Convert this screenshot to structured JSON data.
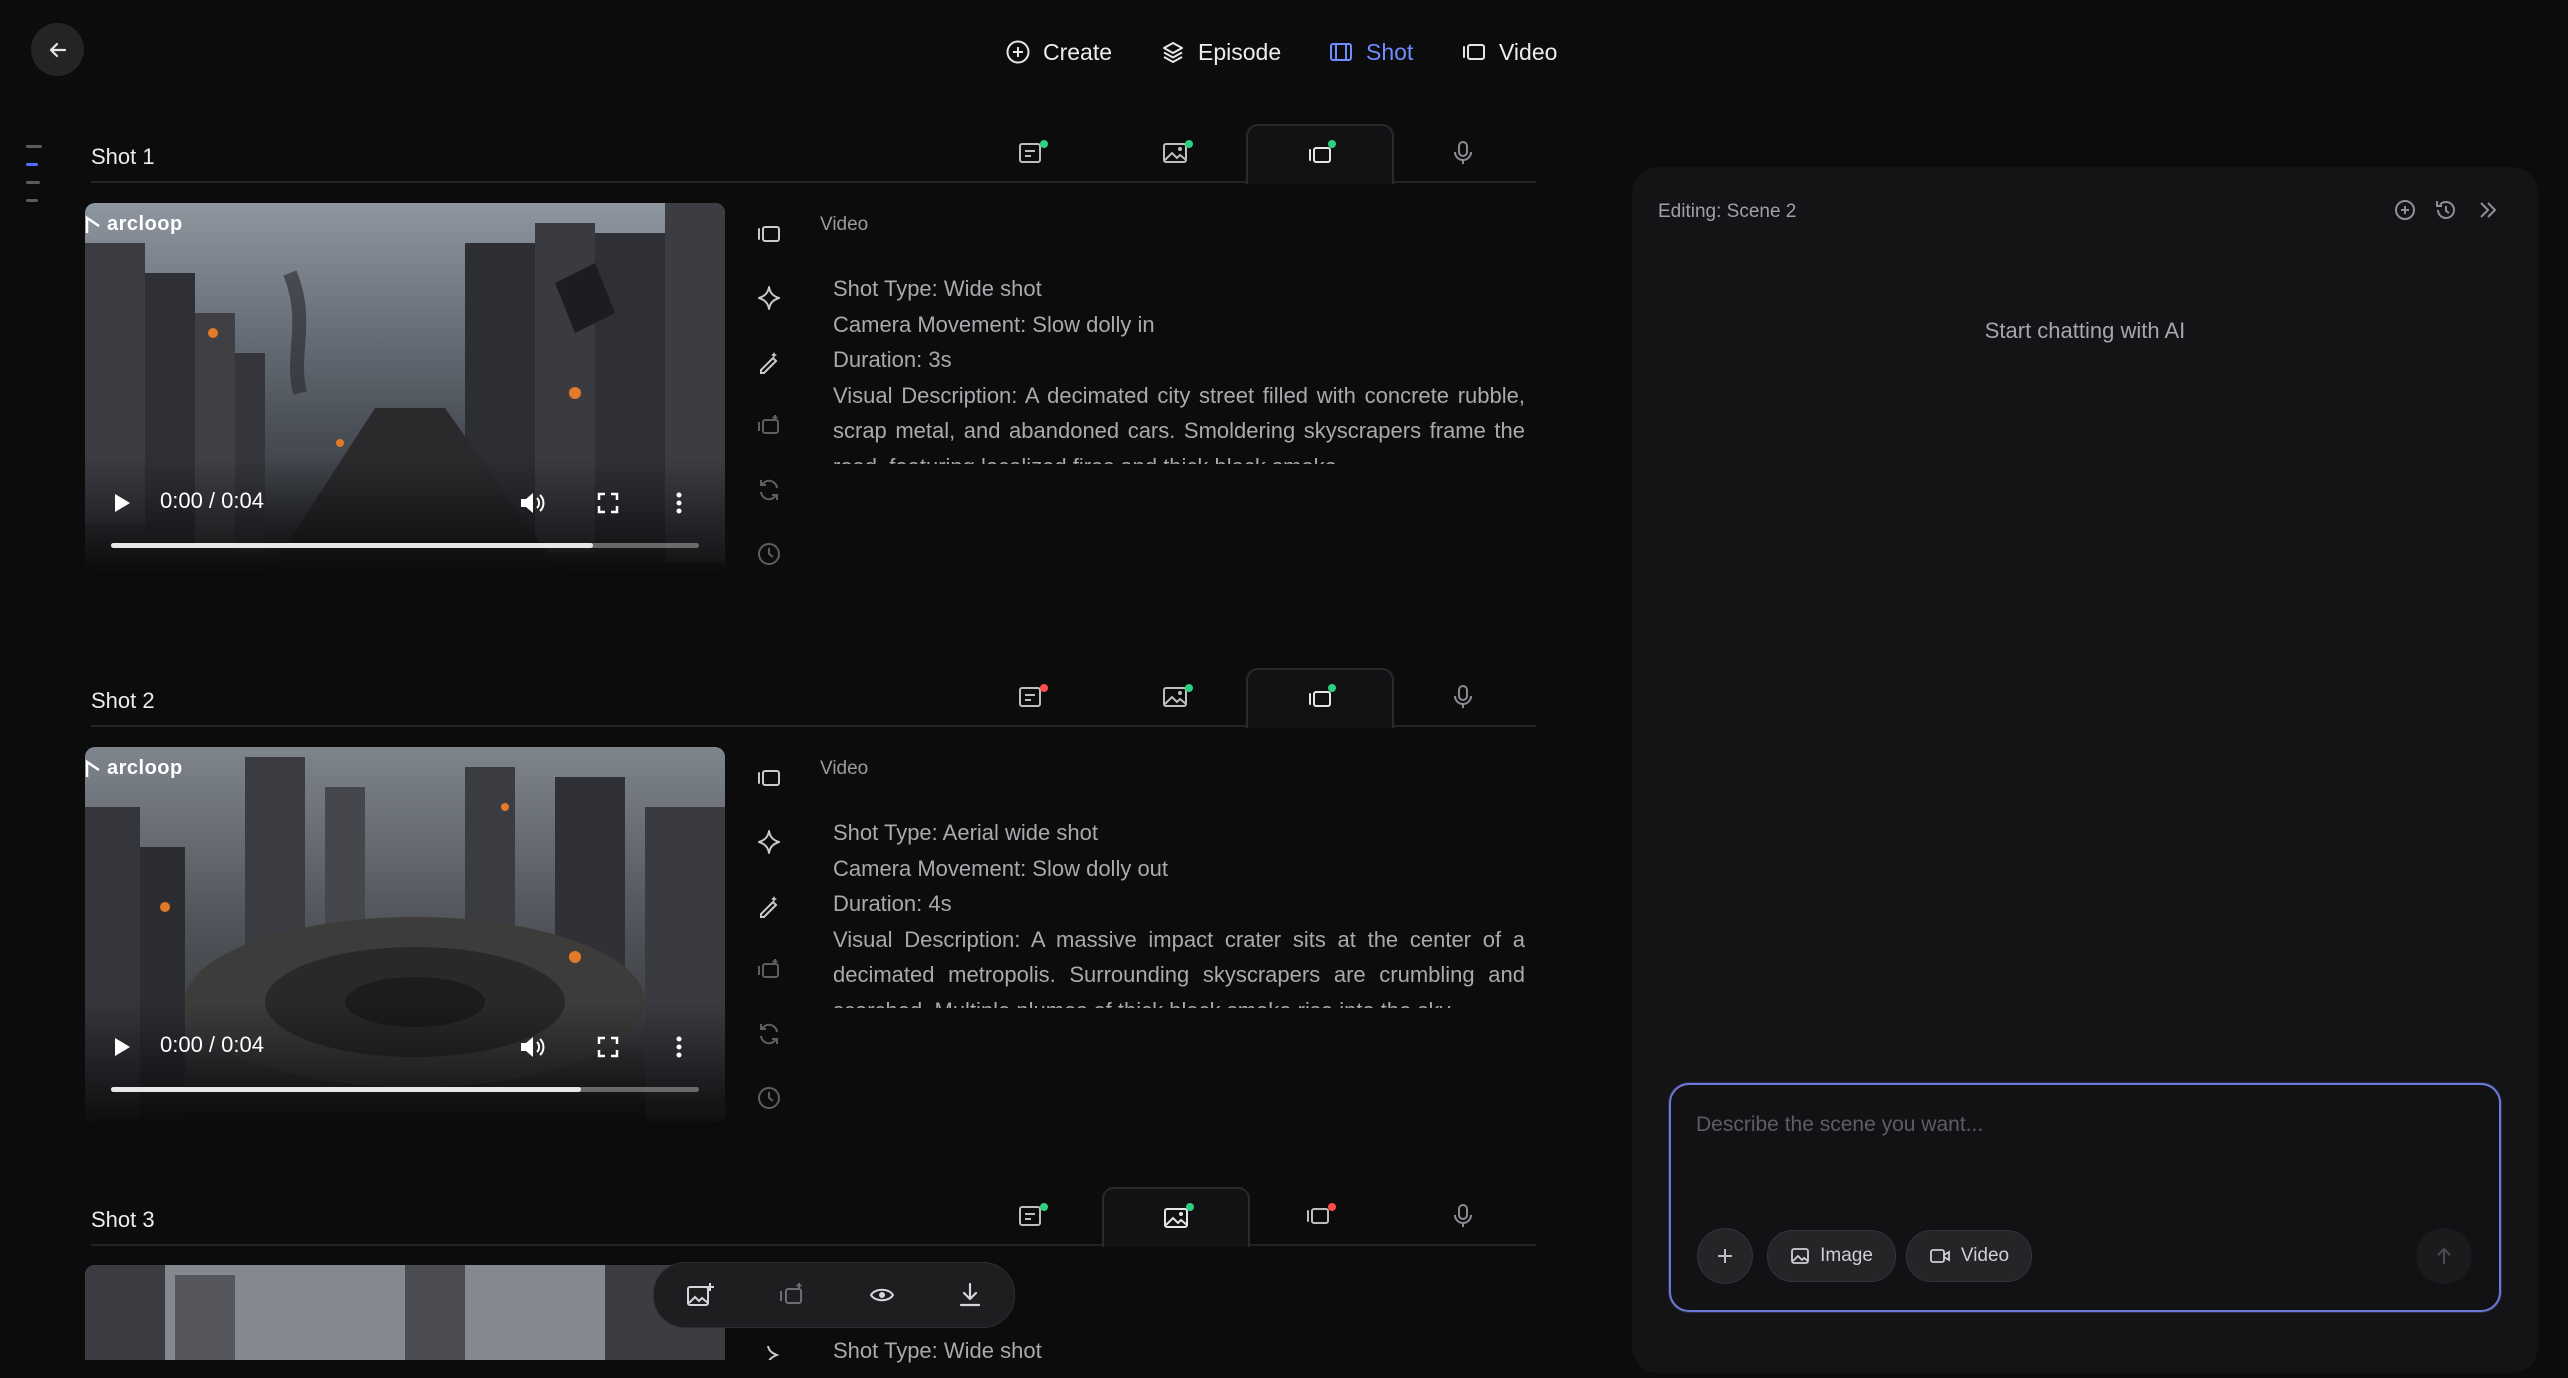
{
  "nav": {
    "items": [
      {
        "label": "Create",
        "icon": "plus-circle-icon"
      },
      {
        "label": "Episode",
        "icon": "layers-icon"
      },
      {
        "label": "Shot",
        "icon": "film-icon"
      },
      {
        "label": "Video",
        "icon": "video-icon"
      }
    ],
    "active": "Shot"
  },
  "shots": [
    {
      "title": "Shot 1",
      "tab_status": [
        "green",
        "green",
        "green",
        "none"
      ],
      "active_tab": 2,
      "section_label": "Video",
      "video": {
        "time": "0:00 / 0:04",
        "progress": 0.82
      },
      "logo": "arcloop",
      "lines": [
        "Shot Type: Wide shot",
        "Camera Movement: Slow dolly in",
        "Duration: 3s",
        "Visual Description: A decimated city street filled with concrete rubble, scrap metal, and abandoned cars. Smoldering skyscrapers frame the road, featuring localized fires and thick black smoke."
      ]
    },
    {
      "title": "Shot 2",
      "tab_status": [
        "red",
        "green",
        "green",
        "none"
      ],
      "active_tab": 2,
      "section_label": "Video",
      "video": {
        "time": "0:00 / 0:04",
        "progress": 0.8
      },
      "logo": "arcloop",
      "lines": [
        "Shot Type: Aerial wide shot",
        "Camera Movement: Slow dolly out",
        "Duration: 4s",
        "Visual Description: A massive impact crater sits at the center of a decimated metropolis. Surrounding skyscrapers are crumbling and scorched. Multiple plumes of thick black smoke rise into the sky."
      ]
    },
    {
      "title": "Shot 3",
      "tab_status": [
        "green",
        "green",
        "red",
        "none"
      ],
      "active_tab": 1,
      "lines": [
        "Shot Type: Wide shot"
      ]
    }
  ],
  "panel": {
    "title": "Editing: Scene 2",
    "empty": "Start chatting with AI",
    "placeholder": "Describe the scene you want...",
    "image_label": "Image",
    "video_label": "Video"
  }
}
